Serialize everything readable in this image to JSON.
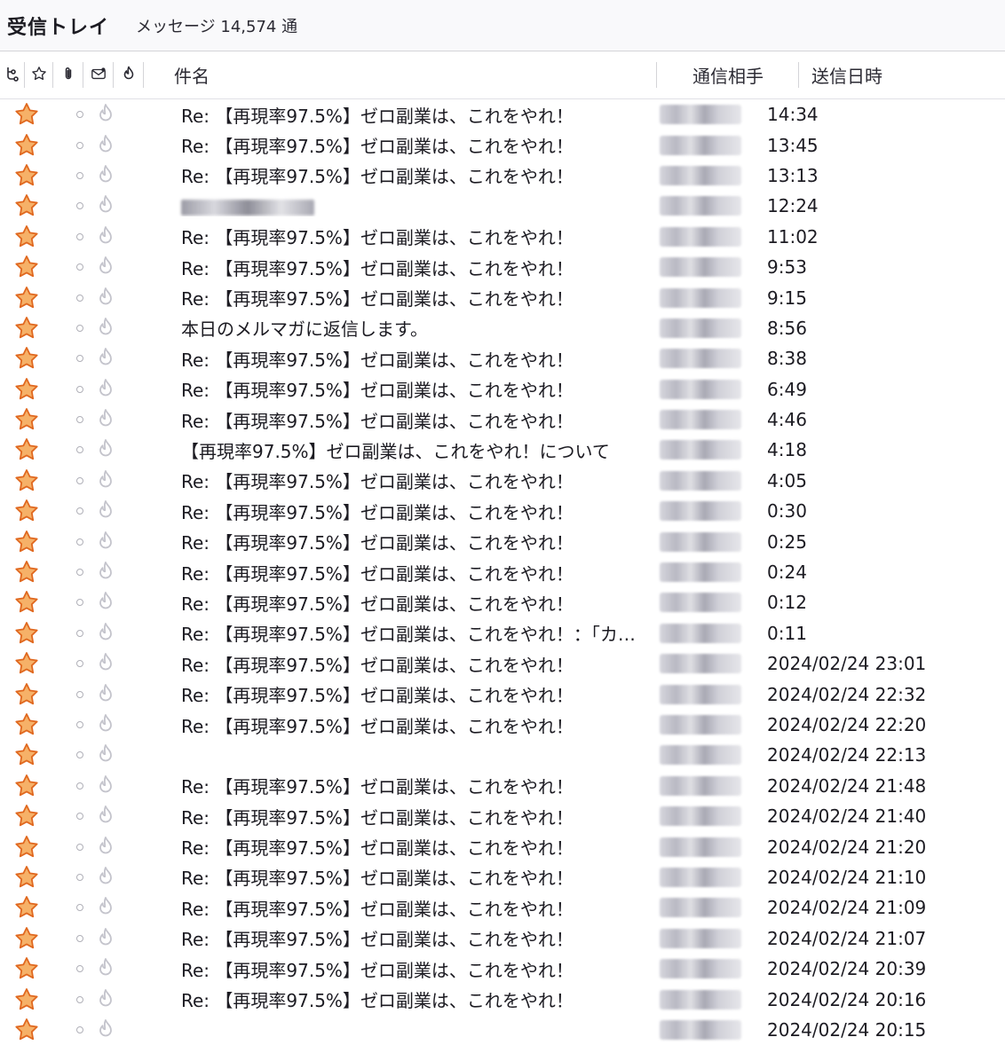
{
  "titlebar": {
    "folder": "受信トレイ",
    "count": "メッセージ 14,574 通"
  },
  "columns": {
    "subject": "件名",
    "correspondent": "通信相手",
    "date": "送信日時"
  },
  "icons": {
    "thread": "thread-icon",
    "star": "star-icon",
    "attachment": "paperclip-icon",
    "read": "read-status-icon",
    "junk": "junk-flame-icon"
  },
  "colors": {
    "star_fill": "#f6b168",
    "star_stroke": "#e0681f"
  },
  "rows": [
    {
      "subject": "Re: 【再現率97.5%】ゼロ副業は、これをやれ！",
      "date": "14:34"
    },
    {
      "subject": "Re: 【再現率97.5%】ゼロ副業は、これをやれ！",
      "date": "13:45"
    },
    {
      "subject": "Re: 【再現率97.5%】ゼロ副業は、これをやれ！",
      "date": "13:13"
    },
    {
      "subject": "",
      "date": "12:24",
      "subject_blurred": true
    },
    {
      "subject": "Re: 【再現率97.5%】ゼロ副業は、これをやれ！",
      "date": "11:02"
    },
    {
      "subject": "Re: 【再現率97.5%】ゼロ副業は、これをやれ！",
      "date": "9:53"
    },
    {
      "subject": "Re: 【再現率97.5%】ゼロ副業は、これをやれ！",
      "date": "9:15"
    },
    {
      "subject": "本日のメルマガに返信します。",
      "date": "8:56"
    },
    {
      "subject": "Re: 【再現率97.5%】ゼロ副業は、これをやれ！",
      "date": "8:38"
    },
    {
      "subject": "Re: 【再現率97.5%】ゼロ副業は、これをやれ！",
      "date": "6:49"
    },
    {
      "subject": "Re: 【再現率97.5%】ゼロ副業は、これをやれ！",
      "date": "4:46"
    },
    {
      "subject": "【再現率97.5%】ゼロ副業は、これをやれ！について",
      "date": "4:18"
    },
    {
      "subject": "Re: 【再現率97.5%】ゼロ副業は、これをやれ！",
      "date": "4:05"
    },
    {
      "subject": "Re: 【再現率97.5%】ゼロ副業は、これをやれ！",
      "date": "0:30"
    },
    {
      "subject": "Re: 【再現率97.5%】ゼロ副業は、これをやれ！",
      "date": "0:25"
    },
    {
      "subject": "Re: 【再現率97.5%】ゼロ副業は、これをやれ！",
      "date": "0:24"
    },
    {
      "subject": "Re: 【再現率97.5%】ゼロ副業は、これをやれ！",
      "date": "0:12"
    },
    {
      "subject": "Re: 【再現率97.5%】ゼロ副業は、これをやれ！：「カ…",
      "date": "0:11"
    },
    {
      "subject": "Re: 【再現率97.5%】ゼロ副業は、これをやれ！",
      "date": "2024/02/24 23:01"
    },
    {
      "subject": "Re: 【再現率97.5%】ゼロ副業は、これをやれ！",
      "date": "2024/02/24 22:32"
    },
    {
      "subject": "Re: 【再現率97.5%】ゼロ副業は、これをやれ！",
      "date": "2024/02/24 22:20"
    },
    {
      "subject": "",
      "date": "2024/02/24 22:13"
    },
    {
      "subject": "Re: 【再現率97.5%】ゼロ副業は、これをやれ！",
      "date": "2024/02/24 21:48"
    },
    {
      "subject": "Re: 【再現率97.5%】ゼロ副業は、これをやれ！",
      "date": "2024/02/24 21:40"
    },
    {
      "subject": "Re: 【再現率97.5%】ゼロ副業は、これをやれ！",
      "date": "2024/02/24 21:20"
    },
    {
      "subject": "Re: 【再現率97.5%】ゼロ副業は、これをやれ！",
      "date": "2024/02/24 21:10"
    },
    {
      "subject": "Re: 【再現率97.5%】ゼロ副業は、これをやれ！",
      "date": "2024/02/24 21:09"
    },
    {
      "subject": "Re: 【再現率97.5%】ゼロ副業は、これをやれ！",
      "date": "2024/02/24 21:07"
    },
    {
      "subject": "Re: 【再現率97.5%】ゼロ副業は、これをやれ！",
      "date": "2024/02/24 20:39"
    },
    {
      "subject": "Re: 【再現率97.5%】ゼロ副業は、これをやれ！",
      "date": "2024/02/24 20:16"
    },
    {
      "subject": "",
      "date": "2024/02/24 20:15"
    }
  ]
}
